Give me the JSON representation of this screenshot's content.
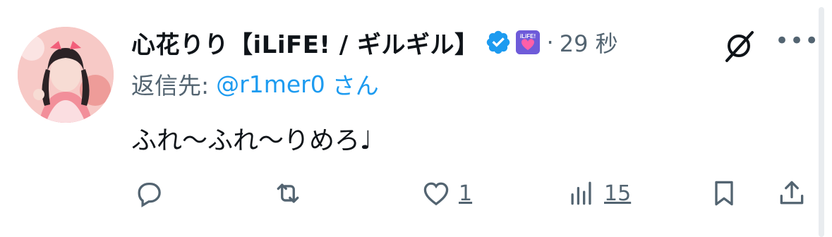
{
  "tweet": {
    "author_name": "心花りり【iLiFE! / ギルギル】",
    "separator": "·",
    "time_ago": "29 秒",
    "reply_label": "返信先:",
    "reply_user": "@r1mer0",
    "reply_suffix": "さん",
    "text": "ふれ〜ふれ〜りめろ♩",
    "affiliation_badge_text": "iLiFE!",
    "icons": {
      "verified": "verified-badge-icon",
      "affiliation": "affiliation-badge-icon",
      "grok": "grok-icon",
      "more": "more-icon"
    }
  },
  "actions": {
    "reply_count": "",
    "retweet_count": "",
    "like_count": "1",
    "views_count": "15"
  },
  "colors": {
    "link": "#1d9bf0",
    "muted": "#536471",
    "verified": "#1d9bf0"
  }
}
